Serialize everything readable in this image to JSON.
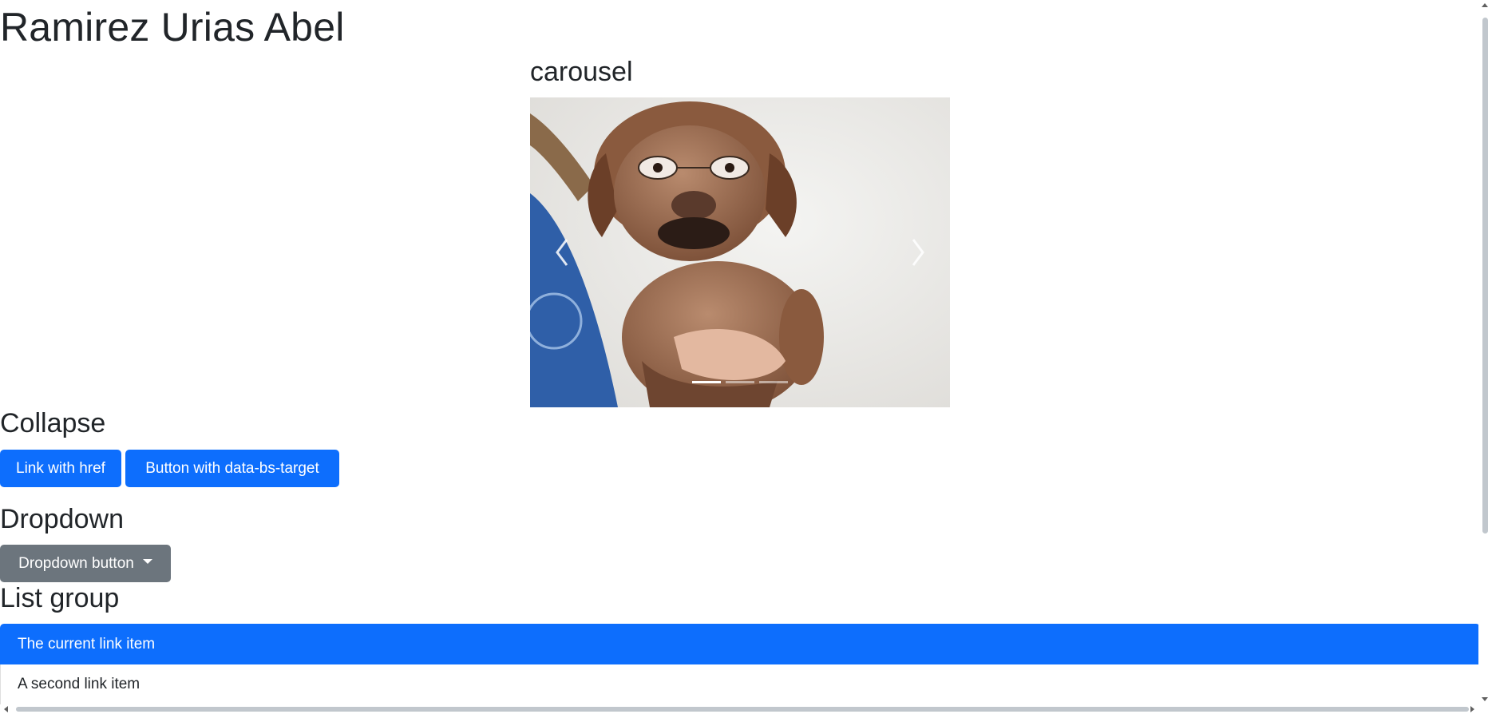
{
  "title": "Ramirez Urias Abel",
  "carousel": {
    "heading": "carousel",
    "prev_icon": "chevron-left-icon",
    "next_icon": "chevron-right-icon",
    "indicator_count": 3,
    "active_index": 0
  },
  "collapse": {
    "heading": "Collapse",
    "link_label": "Link with href",
    "button_label": "Button with data-bs-target"
  },
  "dropdown": {
    "heading": "Dropdown",
    "button_label": "Dropdown button"
  },
  "list_group": {
    "heading": "List group",
    "items": [
      {
        "label": "The current link item",
        "active": true
      },
      {
        "label": "A second link item",
        "active": false
      }
    ]
  },
  "colors": {
    "primary": "#0d6efd",
    "secondary": "#6c757d",
    "text": "#212529"
  }
}
